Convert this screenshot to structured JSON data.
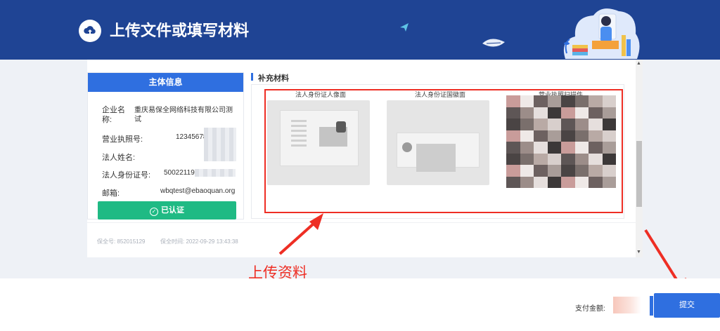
{
  "header": {
    "title": "上传文件或填写材料",
    "bg_color": "#1f4494",
    "logo_icon": "cloud-upload-icon"
  },
  "subject_info": {
    "title": "主体信息",
    "company_label": "企业名称:",
    "company_value": "重庆易保全网络科技有限公司测试",
    "license_label": "营业执照号:",
    "license_value": "12345678",
    "legal_name_label": "法人姓名:",
    "legal_id_label": "法人身份证号:",
    "legal_id_value": "50022119",
    "email_label": "邮箱:",
    "email_value": "wbqtest@ebaoquan.org",
    "verified_label": "已认证",
    "verified_color": "#1fba84"
  },
  "supplement": {
    "title": "补充材料",
    "docs": [
      {
        "label": "法人身份证人像面"
      },
      {
        "label": "法人身份证国徽面"
      },
      {
        "label": "营业执照扫描件"
      }
    ]
  },
  "meta": {
    "preservation_no": "保全号: 852015129",
    "preservation_time": "保全时间: 2022-09-29 13:43:38"
  },
  "annotation": {
    "text": "上传资料",
    "color": "#ee2e24"
  },
  "footer": {
    "pay_label": "支付金额:",
    "submit_label": "提交",
    "accent": "#2f6fe0"
  }
}
